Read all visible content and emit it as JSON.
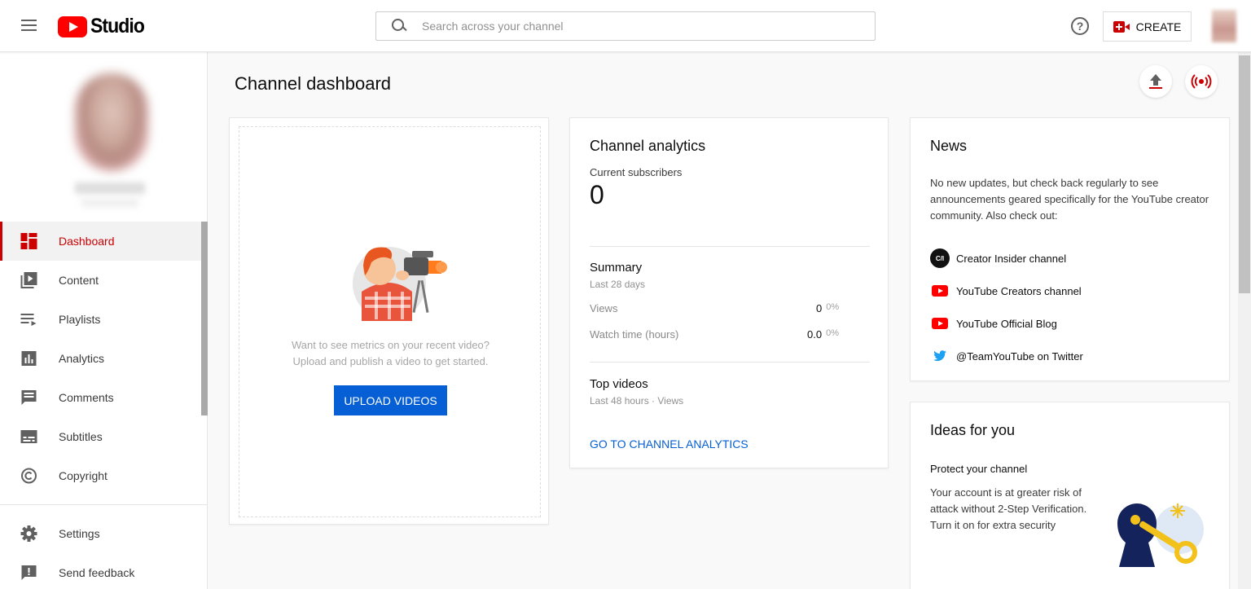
{
  "header": {
    "logo_text": "Studio",
    "search_placeholder": "Search across your channel",
    "help_symbol": "?",
    "create_label": "CREATE"
  },
  "sidebar": {
    "items": [
      {
        "label": "Dashboard",
        "icon": "dashboard-icon",
        "active": true
      },
      {
        "label": "Content",
        "icon": "content-icon"
      },
      {
        "label": "Playlists",
        "icon": "playlists-icon"
      },
      {
        "label": "Analytics",
        "icon": "analytics-icon"
      },
      {
        "label": "Comments",
        "icon": "comments-icon"
      },
      {
        "label": "Subtitles",
        "icon": "subtitles-icon"
      },
      {
        "label": "Copyright",
        "icon": "copyright-icon"
      }
    ],
    "footer_items": [
      {
        "label": "Settings",
        "icon": "gear-icon"
      },
      {
        "label": "Send feedback",
        "icon": "feedback-icon"
      }
    ]
  },
  "main": {
    "title": "Channel dashboard",
    "upload_card": {
      "line1": "Want to see metrics on your recent video?",
      "line2": "Upload and publish a video to get started.",
      "button": "UPLOAD VIDEOS"
    },
    "analytics_card": {
      "title": "Channel analytics",
      "subscribers_label": "Current subscribers",
      "subscribers_value": "0",
      "summary_title": "Summary",
      "summary_period": "Last 28 days",
      "metrics": [
        {
          "label": "Views",
          "value": "0",
          "change": "0%"
        },
        {
          "label": "Watch time (hours)",
          "value": "0.0",
          "change": "0%"
        }
      ],
      "top_videos_title": "Top videos",
      "top_videos_period": "Last 48 hours · Views",
      "link": "GO TO CHANNEL ANALYTICS"
    },
    "news_card": {
      "title": "News",
      "body": "No new updates, but check back regularly to see announcements geared specifically for the YouTube creator community. Also check out:",
      "ci_badge": "C/I",
      "links": [
        {
          "label": "Creator Insider channel",
          "icon": "creator-insider-icon"
        },
        {
          "label": "YouTube Creators channel",
          "icon": "youtube-icon"
        },
        {
          "label": "YouTube Official Blog",
          "icon": "youtube-icon"
        },
        {
          "label": "@TeamYouTube on Twitter",
          "icon": "twitter-icon"
        }
      ]
    },
    "ideas_card": {
      "title": "Ideas for you",
      "subtitle": "Protect your channel",
      "body": "Your account is at greater risk of attack without 2-Step Verification. Turn it on for extra security"
    }
  },
  "colors": {
    "accent_red": "#cc0000",
    "brand_red": "#ff0000",
    "link_blue": "#065fd4"
  }
}
